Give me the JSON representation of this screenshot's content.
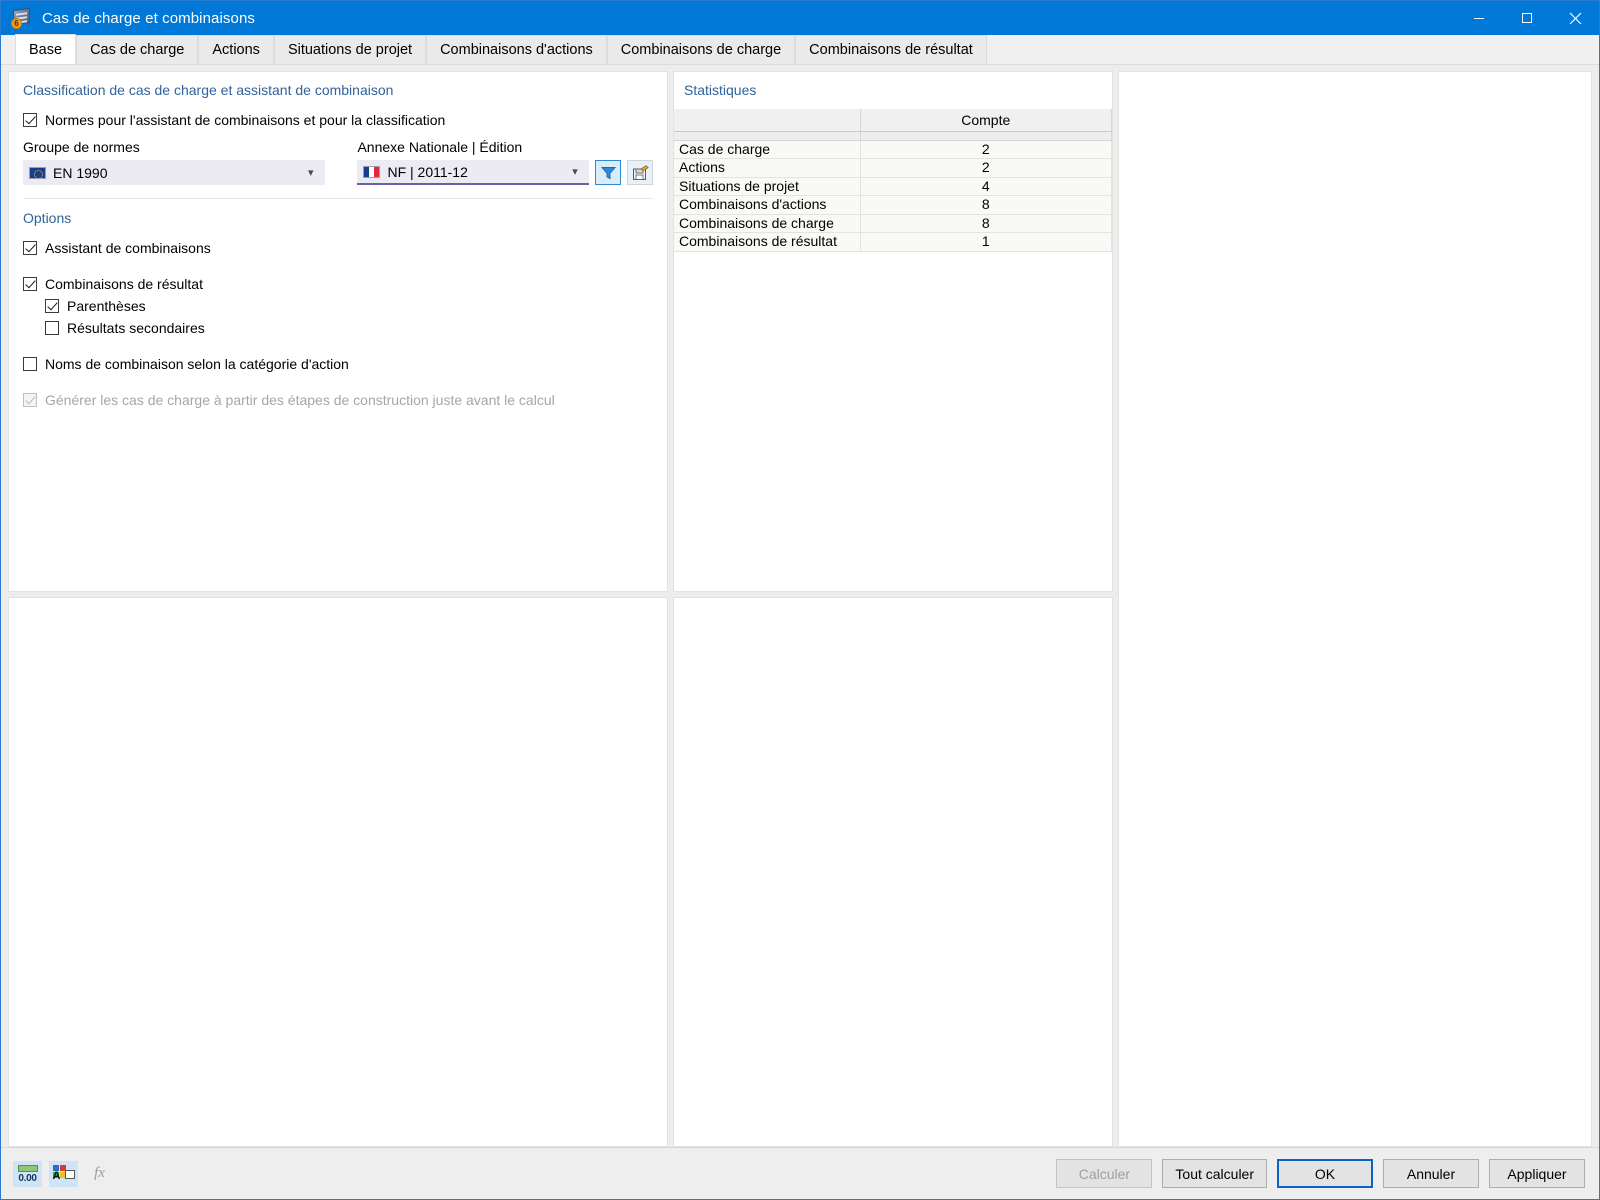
{
  "window": {
    "title": "Cas de charge et combinaisons",
    "app_icon": "book-badge-6-icon",
    "minimize_label": "Réduire",
    "maximize_label": "Agrandir",
    "close_label": "Fermer"
  },
  "tabs": [
    {
      "label": "Base",
      "active": true
    },
    {
      "label": "Cas de charge",
      "active": false
    },
    {
      "label": "Actions",
      "active": false
    },
    {
      "label": "Situations de projet",
      "active": false
    },
    {
      "label": "Combinaisons d'actions",
      "active": false
    },
    {
      "label": "Combinaisons de charge",
      "active": false
    },
    {
      "label": "Combinaisons de résultat",
      "active": false
    }
  ],
  "settings": {
    "group_caption": "Classification de cas de charge et assistant de combinaison",
    "standards_checkbox": {
      "label": "Normes pour l'assistant de combinaisons et pour la classification",
      "checked": true
    },
    "standards_group": {
      "label": "Groupe de normes",
      "value": "EN 1990",
      "flag": "eu-flag-icon",
      "caret": "chevron-down-icon"
    },
    "national_annex": {
      "label": "Annexe Nationale | Édition",
      "value": "NF | 2011-12",
      "flag": "fr-flag-icon",
      "caret": "chevron-down-icon"
    },
    "filter_button": {
      "icon": "filter-funnel-icon",
      "title": "Filtrer"
    },
    "annex_info_button": {
      "icon": "save-annex-icon",
      "title": "Annexe"
    }
  },
  "options": {
    "caption": "Options",
    "items": [
      {
        "label": "Assistant de combinaisons",
        "checked": true,
        "indent": false,
        "disabled": false
      },
      {
        "label": "Combinaisons de résultat",
        "checked": true,
        "indent": false,
        "disabled": false
      },
      {
        "label": "Parenthèses",
        "checked": true,
        "indent": true,
        "disabled": false
      },
      {
        "label": "Résultats secondaires",
        "checked": false,
        "indent": true,
        "disabled": false
      },
      {
        "label": "Noms de combinaison selon la catégorie d'action",
        "checked": false,
        "indent": false,
        "disabled": false
      },
      {
        "label": "Générer les cas de charge à partir des étapes de construction juste avant le calcul",
        "checked": true,
        "indent": false,
        "disabled": true
      }
    ]
  },
  "statistics": {
    "caption": "Statistiques",
    "columns": [
      "",
      "Compte"
    ],
    "rows": [
      {
        "name": "Cas de charge",
        "count": "2"
      },
      {
        "name": "Actions",
        "count": "2"
      },
      {
        "name": "Situations de projet",
        "count": "4"
      },
      {
        "name": "Combinaisons d'actions",
        "count": "8"
      },
      {
        "name": "Combinaisons de charge",
        "count": "8"
      },
      {
        "name": "Combinaisons de résultat",
        "count": "1"
      }
    ]
  },
  "footer": {
    "tools": [
      {
        "icon": "decimal-places-icon",
        "label": "0.00",
        "active": true,
        "disabled": false
      },
      {
        "icon": "legend-colors-icon",
        "label": "",
        "active": true,
        "disabled": false
      },
      {
        "icon": "formula-fx-icon",
        "label": "fx",
        "active": false,
        "disabled": true
      }
    ],
    "buttons": [
      {
        "label": "Calculer",
        "disabled": true,
        "default": false
      },
      {
        "label": "Tout calculer",
        "disabled": false,
        "default": false
      },
      {
        "label": "OK",
        "disabled": false,
        "default": true
      },
      {
        "label": "Annuler",
        "disabled": false,
        "default": false
      },
      {
        "label": "Appliquer",
        "disabled": false,
        "default": false
      }
    ]
  },
  "colors": {
    "titlebar": "#0078d7",
    "caption_blue": "#31639c",
    "accent_border": "#0a64c8",
    "combo_field": "#eceaf2",
    "underline_violet": "#6a5fa8"
  }
}
